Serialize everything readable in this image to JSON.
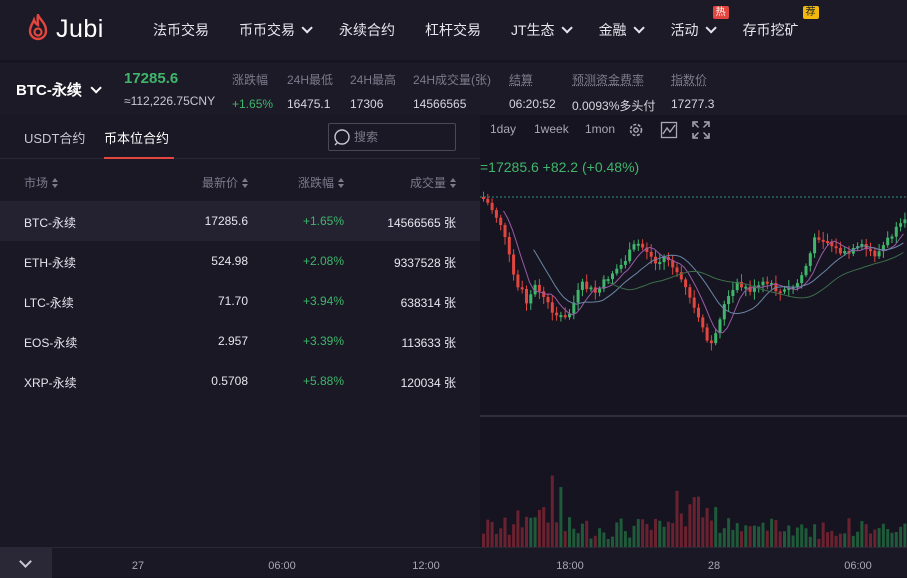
{
  "brand": {
    "name": "Jubi",
    "accent": "#e2463f"
  },
  "nav": {
    "items": [
      {
        "label": "法币交易",
        "dropdown": false
      },
      {
        "label": "币币交易",
        "dropdown": true
      },
      {
        "label": "永续合约",
        "dropdown": false
      },
      {
        "label": "杠杆交易",
        "dropdown": false
      },
      {
        "label": "JT生态",
        "dropdown": true
      },
      {
        "label": "金融",
        "dropdown": true
      },
      {
        "label": "活动",
        "dropdown": true,
        "badge": "热"
      },
      {
        "label": "存币挖矿",
        "dropdown": false,
        "badge": "荐"
      }
    ]
  },
  "ticker": {
    "pair": "BTC-永续",
    "last_price": "17285.6",
    "cny": "≈112,226.75CNY",
    "stats": [
      {
        "label": "涨跌幅",
        "value": "+1.65%"
      },
      {
        "label": "24H最低",
        "value": "16475.1"
      },
      {
        "label": "24H最高",
        "value": "17306"
      },
      {
        "label": "24H成交量(张)",
        "value": "14566565"
      },
      {
        "label": "结算",
        "value": "06:20:52"
      },
      {
        "label": "预测资金费率",
        "value": "0.0093%多头付"
      },
      {
        "label": "指数价",
        "value": "17277.3"
      }
    ]
  },
  "market": {
    "tabs": [
      "USDT合约",
      "币本位合约"
    ],
    "active_tab": 1,
    "search_placeholder": "搜索",
    "headers": [
      "市场",
      "最新价",
      "涨跌幅",
      "成交量"
    ],
    "rows": [
      {
        "name": "BTC-永续",
        "price": "17285.6",
        "change": "+1.65%",
        "volume": "14566565 张"
      },
      {
        "name": "ETH-永续",
        "price": "524.98",
        "change": "+2.08%",
        "volume": "9337528 张"
      },
      {
        "name": "LTC-永续",
        "price": "71.70",
        "change": "+3.94%",
        "volume": "638314 张"
      },
      {
        "name": "EOS-永续",
        "price": "2.957",
        "change": "+3.39%",
        "volume": "113633 张"
      },
      {
        "name": "XRP-永续",
        "price": "0.5708",
        "change": "+5.88%",
        "volume": "120034 张"
      }
    ]
  },
  "chart": {
    "timeframes": [
      "1day",
      "1week",
      "1mon"
    ],
    "legend": "=17285.6  +82.2 (+0.48%)",
    "up_color": "#3fb66b",
    "down_color": "#e2463f",
    "x_ticks": [
      "27",
      "06:00",
      "12:00",
      "18:00",
      "28",
      "06:00"
    ]
  }
}
